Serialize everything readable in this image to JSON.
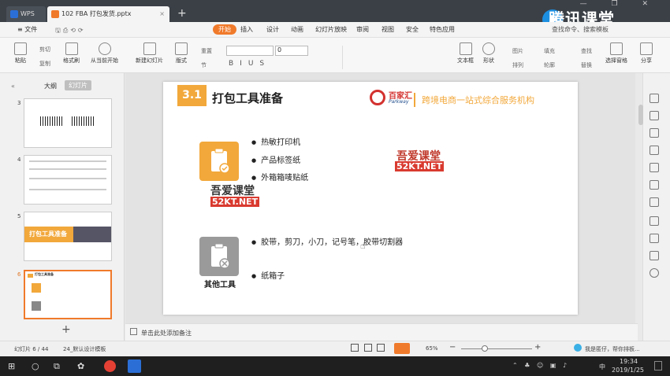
{
  "titlebar": {
    "tab_wps": "WPS",
    "tab_doc": "102 FBA 打包发货.pptx",
    "new_tab": "+",
    "window_controls": "— ❐ ✕",
    "brand": "腾讯课堂"
  },
  "menubar": {
    "file": "≡ 文件",
    "items": [
      "开始",
      "插入",
      "设计",
      "动画",
      "幻灯片放映",
      "审阅",
      "视图",
      "安全",
      "特色应用"
    ],
    "search": "查找命令、搜索模板"
  },
  "ribbon": {
    "paste": "粘贴",
    "cut": "剪切",
    "copy": "复制",
    "format_painter": "格式刷",
    "from_current": "从当前开始",
    "new_slide": "新建幻灯片",
    "layout": "版式",
    "section": "节",
    "reset": "重置",
    "font_size": "0",
    "text_box": "文本框",
    "shape": "形状",
    "image": "图片",
    "fill": "填充",
    "arrange": "排列",
    "outline": "轮廓",
    "find": "查找",
    "replace": "替换",
    "select_pane": "选择窗格",
    "share": "分享"
  },
  "leftpanel": {
    "tab_outline": "大纲",
    "tab_slides": "幻灯片",
    "slide_numbers": [
      "3",
      "4",
      "5",
      "6"
    ],
    "thumb5_title": "打包工具准备",
    "thumb6_title": "打包工具准备",
    "add": "+"
  },
  "slide": {
    "section_num": "3.1",
    "title": "打包工具准备",
    "logo_cn": "百家汇",
    "logo_en": "Parkway",
    "slogan": "跨境电商一站式综合服务机构",
    "group1_bullets": [
      "热敏打印机",
      "产品标签纸",
      "外箱箱唛贴纸"
    ],
    "group2_label": "其他工具",
    "group2_bullets": [
      "胶带，剪刀，小刀，记号笔，胶带切割器",
      "纸箱子"
    ],
    "watermark_cn": "吾爱课堂",
    "watermark_en": "52KT.NET"
  },
  "notes": {
    "placeholder": "单击此处添加备注"
  },
  "statusbar": {
    "slide_info": "幻灯片 6 / 44",
    "template": "24_默认设计模板",
    "zoom": "65%",
    "assistant": "我是匿仔，帮你排板..."
  },
  "taskbar": {
    "time": "19:34",
    "date": "2019/1/25",
    "ime": "中"
  },
  "colors": {
    "accent_orange": "#f2a83b",
    "wps_orange": "#f07a2b",
    "watermark_red": "#d93a2f"
  }
}
